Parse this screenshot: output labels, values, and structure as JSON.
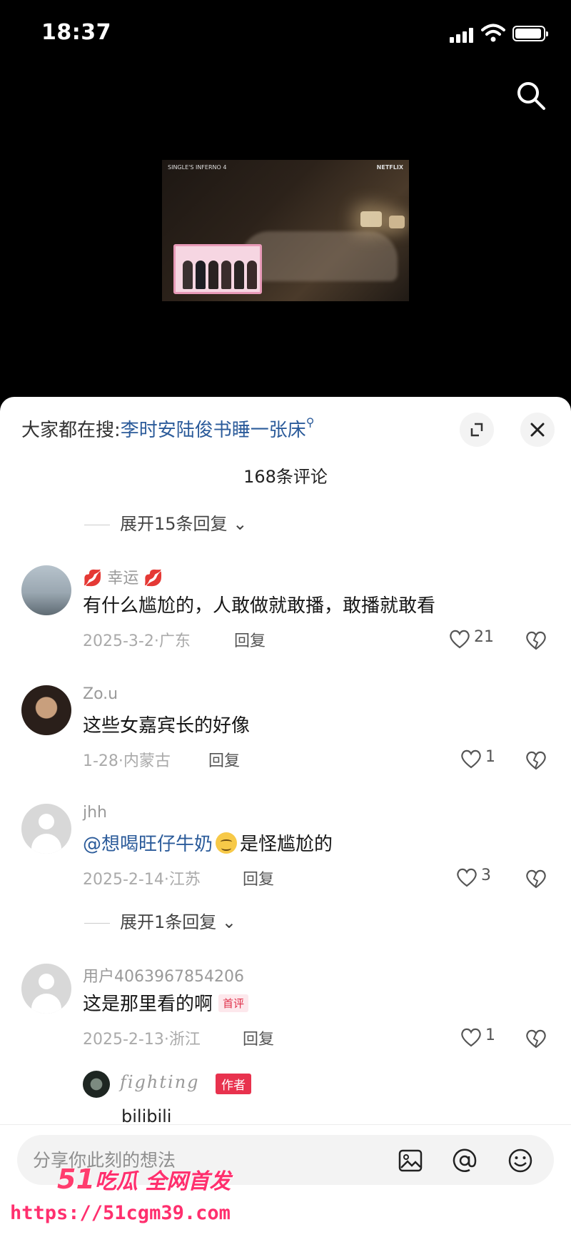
{
  "status_bar": {
    "time": "18:37"
  },
  "video": {
    "show_logo": "SINGLE'S INFERNO 4",
    "brand": "NETFLIX"
  },
  "sheet": {
    "hot_search_prefix": "大家都在搜:",
    "hot_search_query": "李时安陆俊书睡一张床",
    "comment_count": "168条评论",
    "expand_top": "展开15条回复",
    "comments": [
      {
        "author": "幸运",
        "author_decor": "💋",
        "text": "有什么尴尬的，人敢做就敢播，敢播就敢看",
        "meta": "2025-3-2·广东",
        "reply_label": "回复",
        "likes": "21"
      },
      {
        "author": "Zo.u",
        "text": "这些女嘉宾长的好像",
        "meta": "1-28·内蒙古",
        "reply_label": "回复",
        "likes": "1"
      },
      {
        "author": "jhh",
        "mention": "@想喝旺仔牛奶",
        "text": "是怪尴尬的",
        "meta": "2025-2-14·江苏",
        "reply_label": "回复",
        "likes": "3",
        "expand": "展开1条回复"
      },
      {
        "author": "用户4063967854206",
        "text": "这是那里看的啊",
        "badge": "首评",
        "meta": "2025-2-13·浙江",
        "reply_label": "回复",
        "likes": "1",
        "sub_reply": {
          "author": "fighting",
          "author_tag": "作者",
          "text": "bilibili"
        }
      }
    ]
  },
  "input": {
    "placeholder": "分享你此刻的想法"
  },
  "watermark": {
    "logo_num": "51",
    "logo_text": "吃瓜 全网首发",
    "url": "https://51cgm39.com"
  },
  "colors": {
    "accent_link": "#2b5b9a",
    "author_tag": "#e8324e",
    "watermark": "#ff2f6e"
  }
}
